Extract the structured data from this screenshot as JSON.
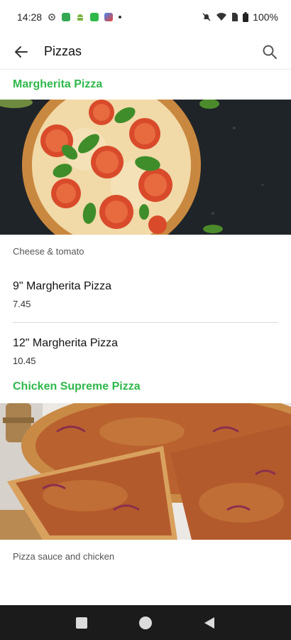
{
  "status_bar": {
    "time": "14:28",
    "battery": "100%"
  },
  "app_bar": {
    "title": "Pizzas",
    "back_icon": "arrow-left-icon",
    "search_icon": "search-icon"
  },
  "colors": {
    "accent": "#2fb84a",
    "nav_background": "#1b1b1b"
  },
  "sections": [
    {
      "title": "Margherita Pizza",
      "description": "Cheese & tomato",
      "items": [
        {
          "name": "9\" Margherita Pizza",
          "price": "7.45"
        },
        {
          "name": "12\" Margherita Pizza",
          "price": "10.45"
        }
      ]
    },
    {
      "title": "Chicken Supreme Pizza",
      "description": "Pizza sauce and chicken"
    }
  ],
  "nav_bar": {
    "buttons": [
      "recents-square-icon",
      "home-circle-icon",
      "back-triangle-icon"
    ]
  }
}
